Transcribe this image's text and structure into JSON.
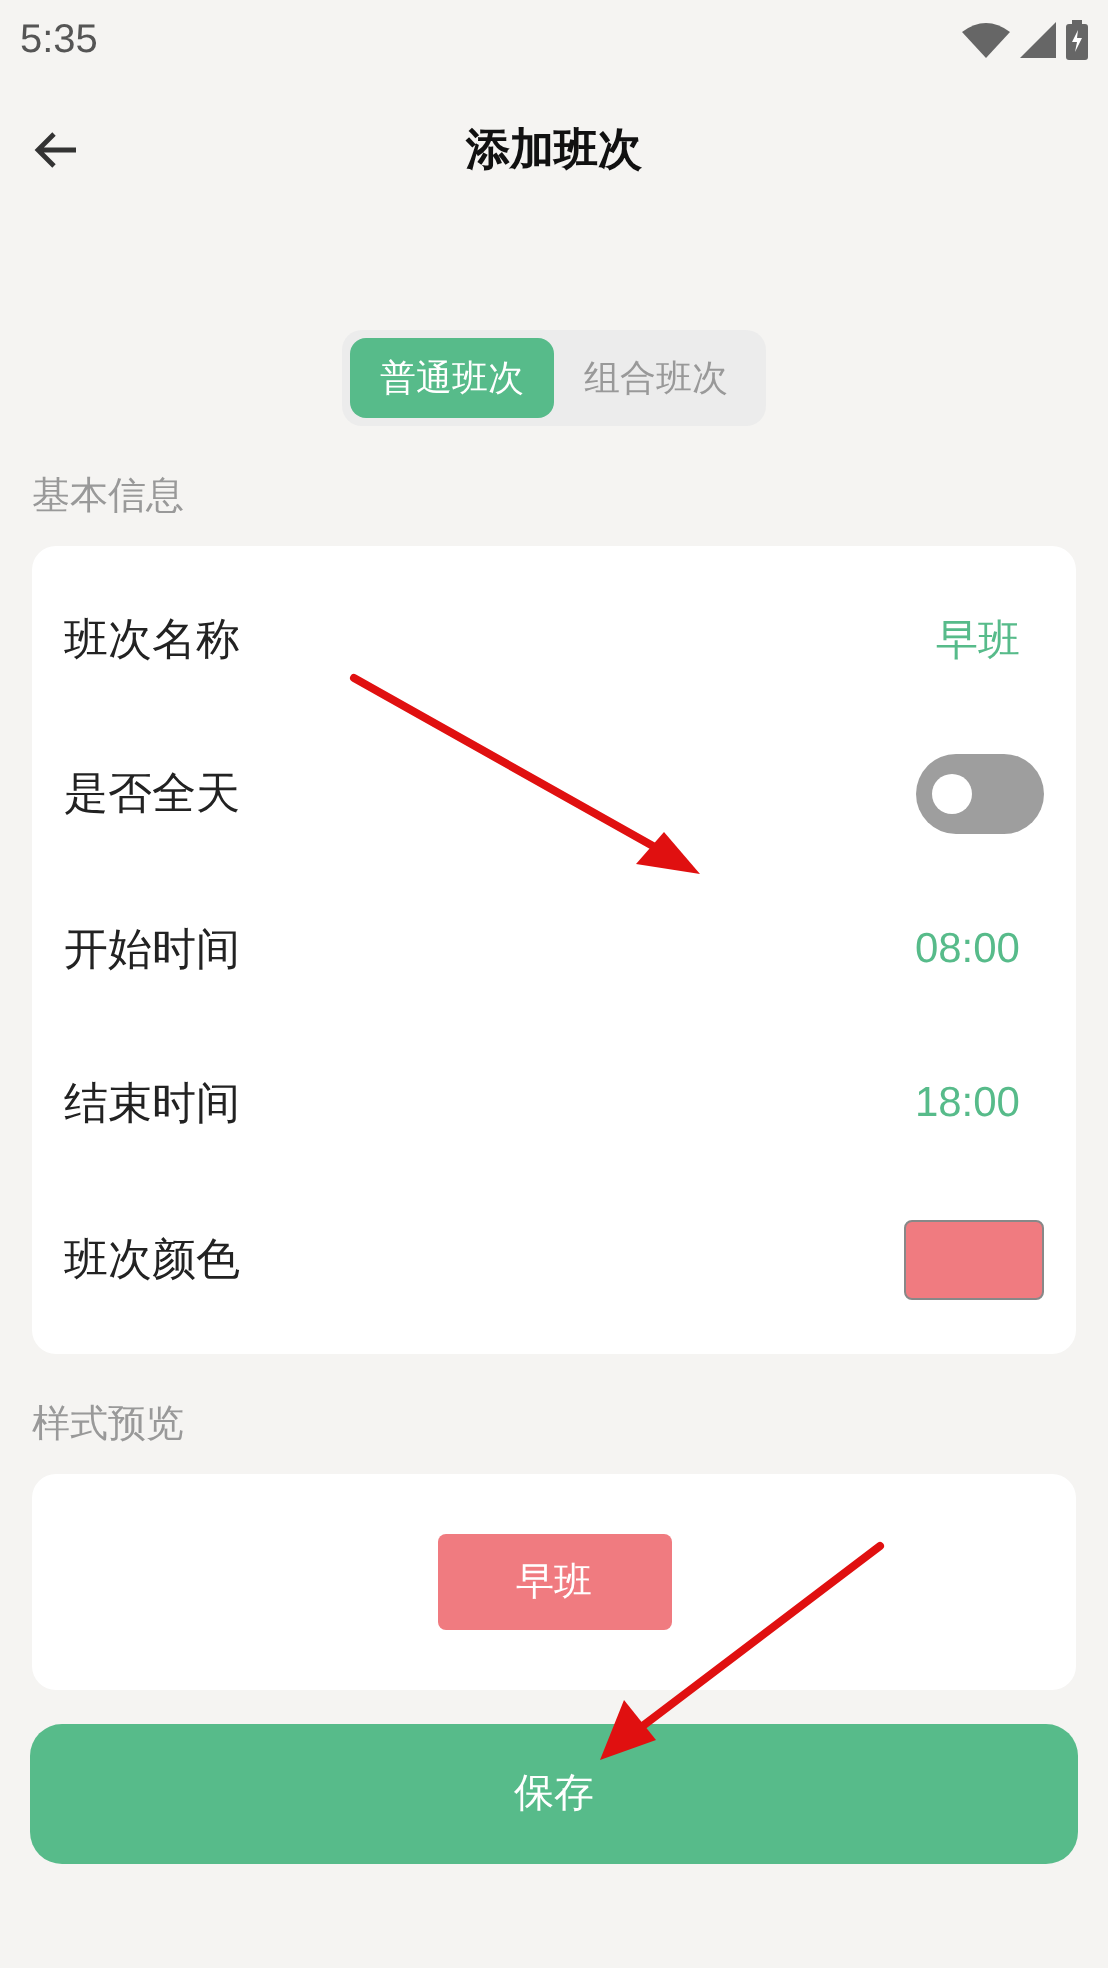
{
  "status_bar": {
    "time": "5:35"
  },
  "header": {
    "title": "添加班次"
  },
  "segments": [
    {
      "label": "普通班次",
      "selected": true
    },
    {
      "label": "组合班次",
      "selected": false
    }
  ],
  "basic_info": {
    "heading": "基本信息",
    "rows": [
      {
        "kind": "text",
        "label": "班次名称",
        "value": "早班"
      },
      {
        "kind": "toggle",
        "label": "是否全天",
        "on": false
      },
      {
        "kind": "text",
        "label": "开始时间",
        "value": "08:00"
      },
      {
        "kind": "text",
        "label": "结束时间",
        "value": "18:00"
      },
      {
        "kind": "color",
        "label": "班次颜色",
        "color": "#f07b80"
      }
    ]
  },
  "preview": {
    "heading": "样式预览",
    "chip": "早班",
    "color": "#f07b80"
  },
  "save_button": "保存"
}
